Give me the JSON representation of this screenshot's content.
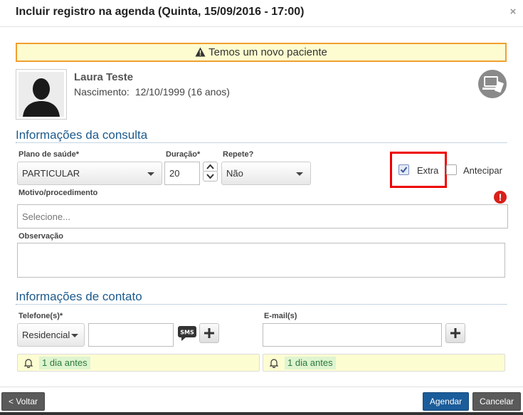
{
  "dialog": {
    "title": "Incluir registro na agenda (Quinta, 15/09/2016 - 17:00)",
    "close_glyph": "×"
  },
  "alert": {
    "text": "Temos um novo paciente",
    "icon": "warning-icon"
  },
  "patient": {
    "name": "Laura Teste",
    "birth_label": "Nascimento:",
    "birth_value": "12/10/1999 (16 anos)"
  },
  "consulta": {
    "heading": "Informações da consulta",
    "plano_label": "Plano de saúde*",
    "plano_value": "PARTICULAR",
    "duracao_label": "Duração*",
    "duracao_value": "20",
    "repete_label": "Repete?",
    "repete_value": "Não",
    "extra_label": "Extra",
    "extra_checked": true,
    "antecipar_label": "Antecipar",
    "antecipar_checked": false,
    "motivo_label": "Motivo/procedimento",
    "motivo_placeholder": "Selecione...",
    "obs_label": "Observação",
    "obs_value": "",
    "error_glyph": "!"
  },
  "contato": {
    "heading": "Informações de contato",
    "telefone_label": "Telefone(s)*",
    "telefone_type": "Residencial",
    "telefone_value": "",
    "sms_label": "SMS",
    "email_label": "E-mail(s)",
    "email_value": "",
    "reminder_phone": "1 dia antes",
    "reminder_email": "1 dia antes"
  },
  "footer": {
    "back": "< Voltar",
    "schedule": "Agendar",
    "cancel": "Cancelar"
  },
  "colors": {
    "accent": "#1b5c9a",
    "section": "#1c5a8c",
    "alert_border": "#f0a030",
    "highlight_box": "#e00000",
    "error": "#d9201b"
  }
}
